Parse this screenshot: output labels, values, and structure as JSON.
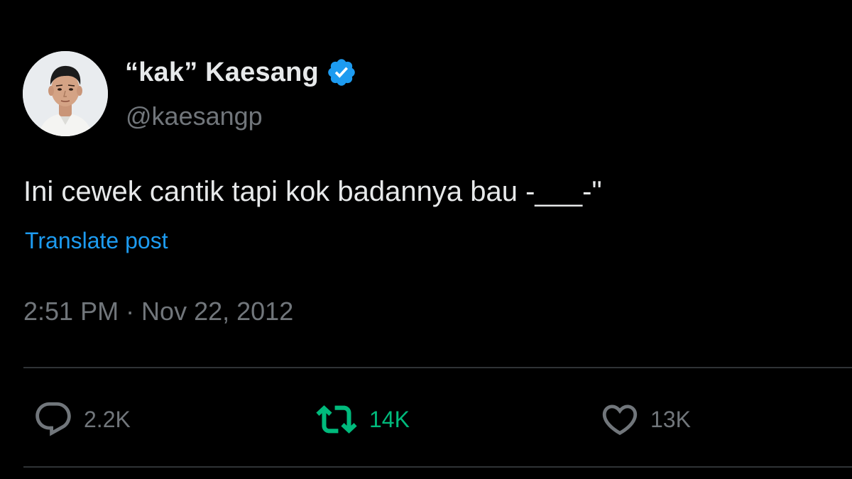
{
  "author": {
    "display_name": "“kak” Kaesang",
    "handle": "@kaesangp",
    "verified_icon": "verified-badge-icon",
    "verified_color": "#1d9bf0"
  },
  "tweet": {
    "text": "Ini cewek cantik tapi kok badannya bau -___-\"",
    "translate_label": "Translate post",
    "timestamp": "2:51 PM · Nov 22, 2012"
  },
  "actions": {
    "reply": {
      "icon": "reply-icon",
      "count": "2.2K"
    },
    "retweet": {
      "icon": "retweet-icon",
      "count": "14K",
      "active_color": "#00ba7c"
    },
    "like": {
      "icon": "heart-icon",
      "count": "13K"
    }
  },
  "colors": {
    "background": "#000000",
    "primary_text": "#e7e9ea",
    "secondary_text": "#71767b",
    "link": "#1d9bf0",
    "divider": "#2f3336"
  }
}
